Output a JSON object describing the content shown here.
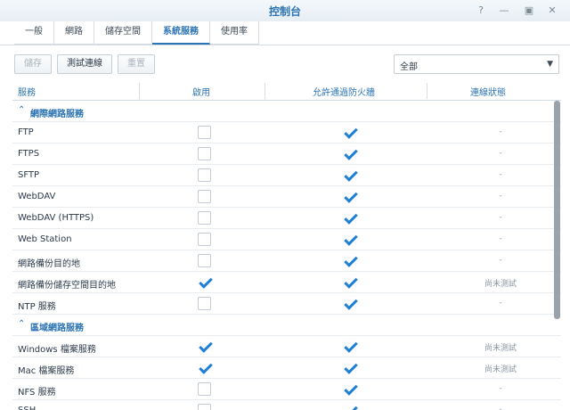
{
  "window": {
    "title": "控制台"
  },
  "tabs": [
    {
      "label": "一般"
    },
    {
      "label": "網路"
    },
    {
      "label": "儲存空間"
    },
    {
      "label": "系統服務"
    },
    {
      "label": "使用率"
    }
  ],
  "toolbar": {
    "save_label": "儲存",
    "test_label": "測試連線",
    "reset_label": "重置"
  },
  "filter": {
    "value": "全部"
  },
  "columns": [
    "服務",
    "啟用",
    "允許通過防火牆",
    "連線狀態"
  ],
  "rows": [
    {
      "type": "group",
      "name": "網際網路服務"
    },
    {
      "name": "FTP",
      "enabled": false,
      "firewall": true,
      "status": "-"
    },
    {
      "name": "FTPS",
      "enabled": false,
      "firewall": true,
      "status": "-"
    },
    {
      "name": "SFTP",
      "enabled": false,
      "firewall": true,
      "status": "-"
    },
    {
      "name": "WebDAV",
      "enabled": false,
      "firewall": true,
      "status": "-"
    },
    {
      "name": "WebDAV (HTTPS)",
      "enabled": false,
      "firewall": true,
      "status": "-"
    },
    {
      "name": "Web Station",
      "enabled": false,
      "firewall": true,
      "status": "-"
    },
    {
      "name": "網路備份目的地",
      "enabled": false,
      "firewall": true,
      "status": "-"
    },
    {
      "name": "網路備份儲存空間目的地",
      "enabled": true,
      "firewall": true,
      "status": "尚未測試"
    },
    {
      "name": "NTP 服務",
      "enabled": false,
      "firewall": true,
      "status": "-"
    },
    {
      "type": "group",
      "name": "區域網路服務"
    },
    {
      "name": "Windows 檔案服務",
      "enabled": true,
      "firewall": true,
      "status": "尚未測試"
    },
    {
      "name": "Mac 檔案服務",
      "enabled": true,
      "firewall": true,
      "status": "尚未測試"
    },
    {
      "name": "NFS 服務",
      "enabled": false,
      "firewall": true,
      "status": "-"
    },
    {
      "name": "SSH",
      "enabled": false,
      "firewall": true,
      "status": "-"
    }
  ]
}
